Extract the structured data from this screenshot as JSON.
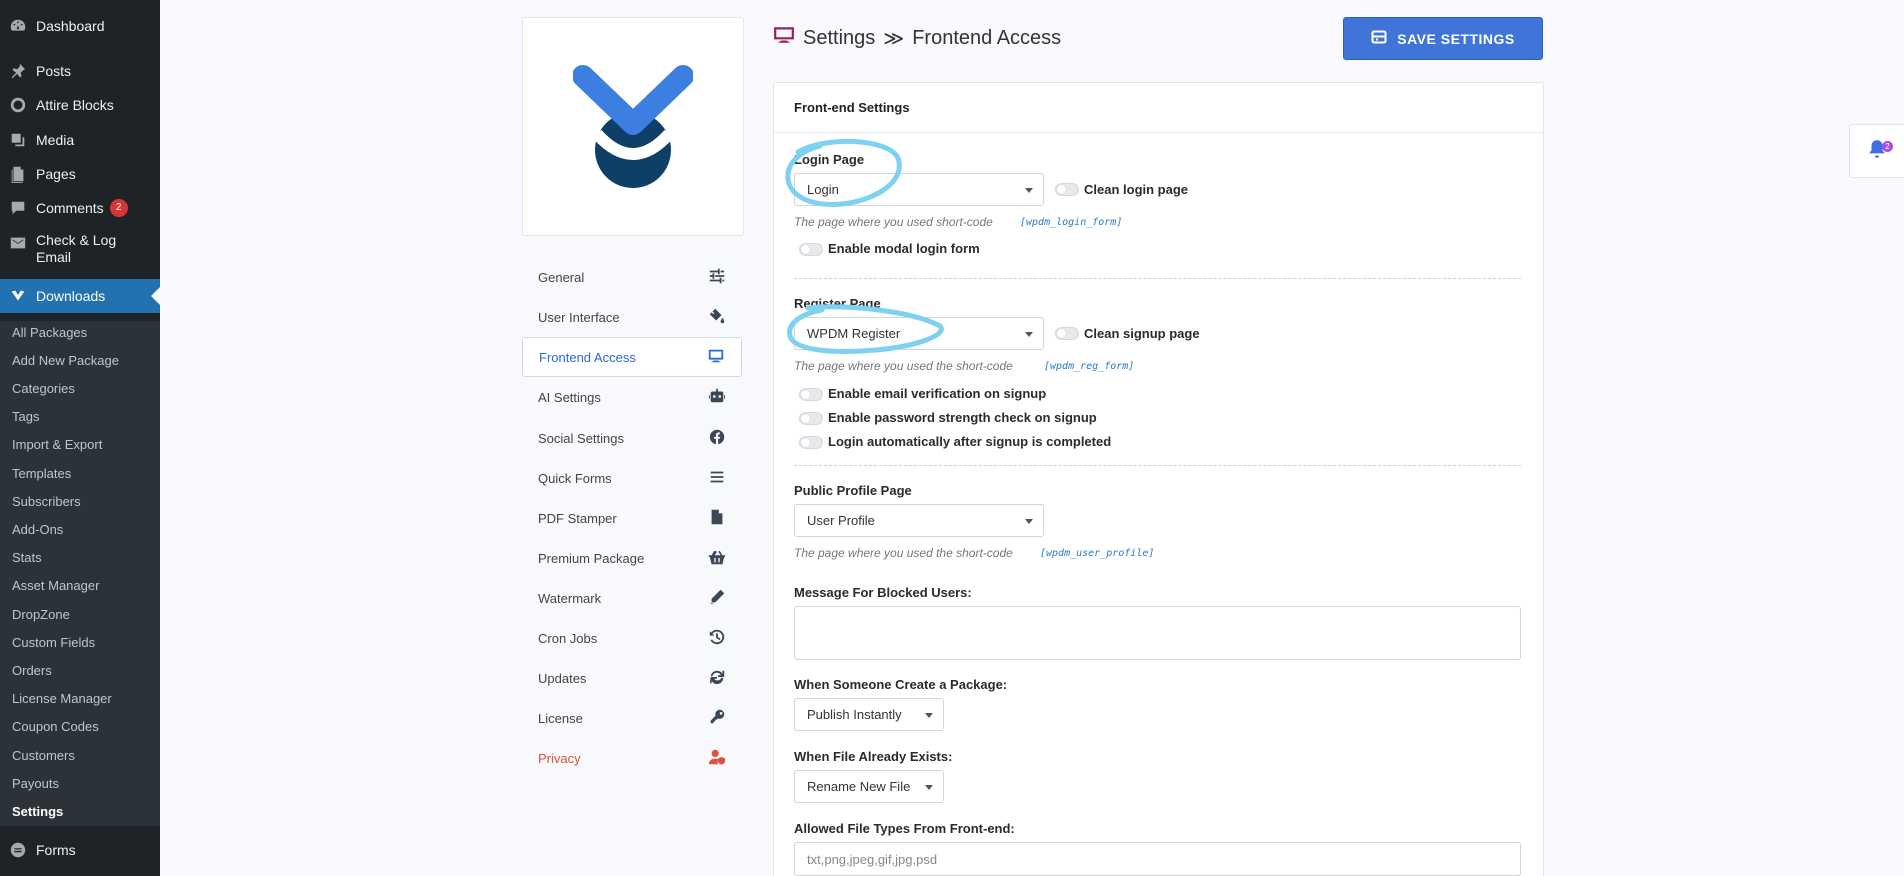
{
  "admin_menu": {
    "top_items": [
      {
        "label": "Dashboard",
        "icon": "dashboard-icon"
      },
      {
        "label": "Posts",
        "icon": "pin-icon"
      },
      {
        "label": "Attire Blocks",
        "icon": "blocks-icon"
      },
      {
        "label": "Media",
        "icon": "media-icon"
      },
      {
        "label": "Pages",
        "icon": "pages-icon"
      },
      {
        "label": "Comments",
        "icon": "comments-icon",
        "badge": "2"
      },
      {
        "label": "Check & Log",
        "label2": "Email",
        "icon": "email-icon"
      },
      {
        "label": "Downloads",
        "icon": "downloads-icon"
      }
    ],
    "submenu": [
      "All Packages",
      "Add New Package",
      "Categories",
      "Tags",
      "Import & Export",
      "Templates",
      "Subscribers",
      "Add-Ons",
      "Stats",
      "Asset Manager",
      "DropZone",
      "Custom Fields",
      "Orders",
      "License Manager",
      "Coupon Codes",
      "Customers",
      "Payouts",
      "Settings"
    ],
    "forms": "Forms"
  },
  "settings_nav": [
    "General",
    "User Interface",
    "Frontend Access",
    "AI Settings",
    "Social Settings",
    "Quick Forms",
    "PDF Stamper",
    "Premium Package",
    "Watermark",
    "Cron Jobs",
    "Updates",
    "License",
    "Privacy"
  ],
  "header": {
    "section": "Settings",
    "separator": "≫",
    "page": "Frontend Access",
    "save_label": "SAVE SETTINGS"
  },
  "panel": {
    "title": "Front-end Settings",
    "login": {
      "label": "Login Page",
      "selected": "Login",
      "clean_label": "Clean login page",
      "hint": "The page where you used short-code",
      "code": "[wpdm_login_form]",
      "modal_label": "Enable modal login form"
    },
    "register": {
      "label": "Register Page",
      "selected": "WPDM Register",
      "clean_label": "Clean signup page",
      "hint": "The page where you used the short-code",
      "code": "[wpdm_reg_form]",
      "opt1": "Enable email verification on signup",
      "opt2": "Enable password strength check on signup",
      "opt3": "Login automatically after signup is completed"
    },
    "profile": {
      "label": "Public Profile Page",
      "selected": "User Profile",
      "hint": "The page where you used the short-code",
      "code": "[wpdm_user_profile]"
    },
    "blocked_label": "Message For Blocked Users:",
    "create_label": "When Someone Create a Package:",
    "create_selected": "Publish Instantly",
    "exists_label": "When File Already Exists:",
    "exists_selected": "Rename New File",
    "types_label": "Allowed File Types From Front-end:",
    "types_value": "txt,png,jpeg,gif,jpg,psd"
  },
  "notification": {
    "count": "2"
  },
  "colors": {
    "accent": "#3f74d9",
    "annotation": "#7fd1f2",
    "logo_light": "#3d7fe0",
    "logo_dark": "#0e3f66"
  }
}
